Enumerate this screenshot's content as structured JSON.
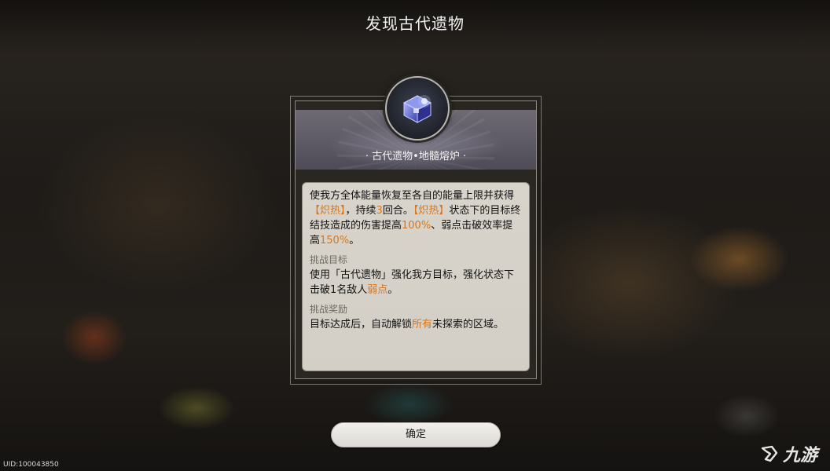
{
  "screen": {
    "title": "发现古代遗物"
  },
  "relic": {
    "name": "· 古代遗物•地髓熔炉 ·",
    "icon": "relic-chest-icon"
  },
  "description": {
    "effect": [
      {
        "text": "使我方全体能量恢复至各自的能量上限并获得",
        "highlight": false
      },
      {
        "text": "【炽热】",
        "highlight": true
      },
      {
        "text": "，持续",
        "highlight": false
      },
      {
        "text": "3",
        "highlight": true
      },
      {
        "text": "回合。",
        "highlight": false
      },
      {
        "text": "【炽热】",
        "highlight": true
      },
      {
        "text": "状态下的目标终结技造成的伤害提高",
        "highlight": false
      },
      {
        "text": "100%",
        "highlight": true
      },
      {
        "text": "、弱点击破效率提高",
        "highlight": false
      },
      {
        "text": "150%",
        "highlight": true
      },
      {
        "text": "。",
        "highlight": false
      }
    ],
    "challenge_label": "挑战目标",
    "challenge": [
      {
        "text": "使用「古代遗物」强化我方目标，强化状态下击破1名敌人",
        "highlight": false
      },
      {
        "text": "弱点",
        "highlight": true
      },
      {
        "text": "。",
        "highlight": false
      }
    ],
    "reward_label": "挑战奖励",
    "reward": [
      {
        "text": "目标达成后，自动解锁",
        "highlight": false
      },
      {
        "text": "所有",
        "highlight": true
      },
      {
        "text": "未探索的区域。",
        "highlight": false
      }
    ]
  },
  "confirm_button": "确定",
  "uid": "UID:100043850",
  "watermark": "九游",
  "colors": {
    "highlight": "#d8751a",
    "panel_bg": "#d8d4cc",
    "title": "#f1f1f1"
  }
}
